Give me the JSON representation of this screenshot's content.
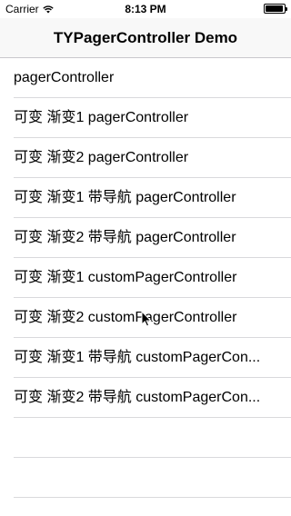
{
  "status_bar": {
    "carrier": "Carrier",
    "time": "8:13 PM",
    "wifi_icon": "wifi-icon",
    "battery_icon": "battery-icon"
  },
  "nav": {
    "title": "TYPagerController Demo"
  },
  "table": {
    "rows": [
      {
        "label": "pagerController"
      },
      {
        "label": "可变 渐变1 pagerController"
      },
      {
        "label": "可变 渐变2 pagerController"
      },
      {
        "label": "可变 渐变1 带导航 pagerController"
      },
      {
        "label": "可变 渐变2 带导航 pagerController"
      },
      {
        "label": "可变 渐变1 customPagerController"
      },
      {
        "label": "可变 渐变2 customPagerController"
      },
      {
        "label": "可变 渐变1 带导航 customPagerCon..."
      },
      {
        "label": "可变 渐变2 带导航 customPagerCon..."
      }
    ]
  },
  "cursor_icon": "mouse-pointer-icon"
}
